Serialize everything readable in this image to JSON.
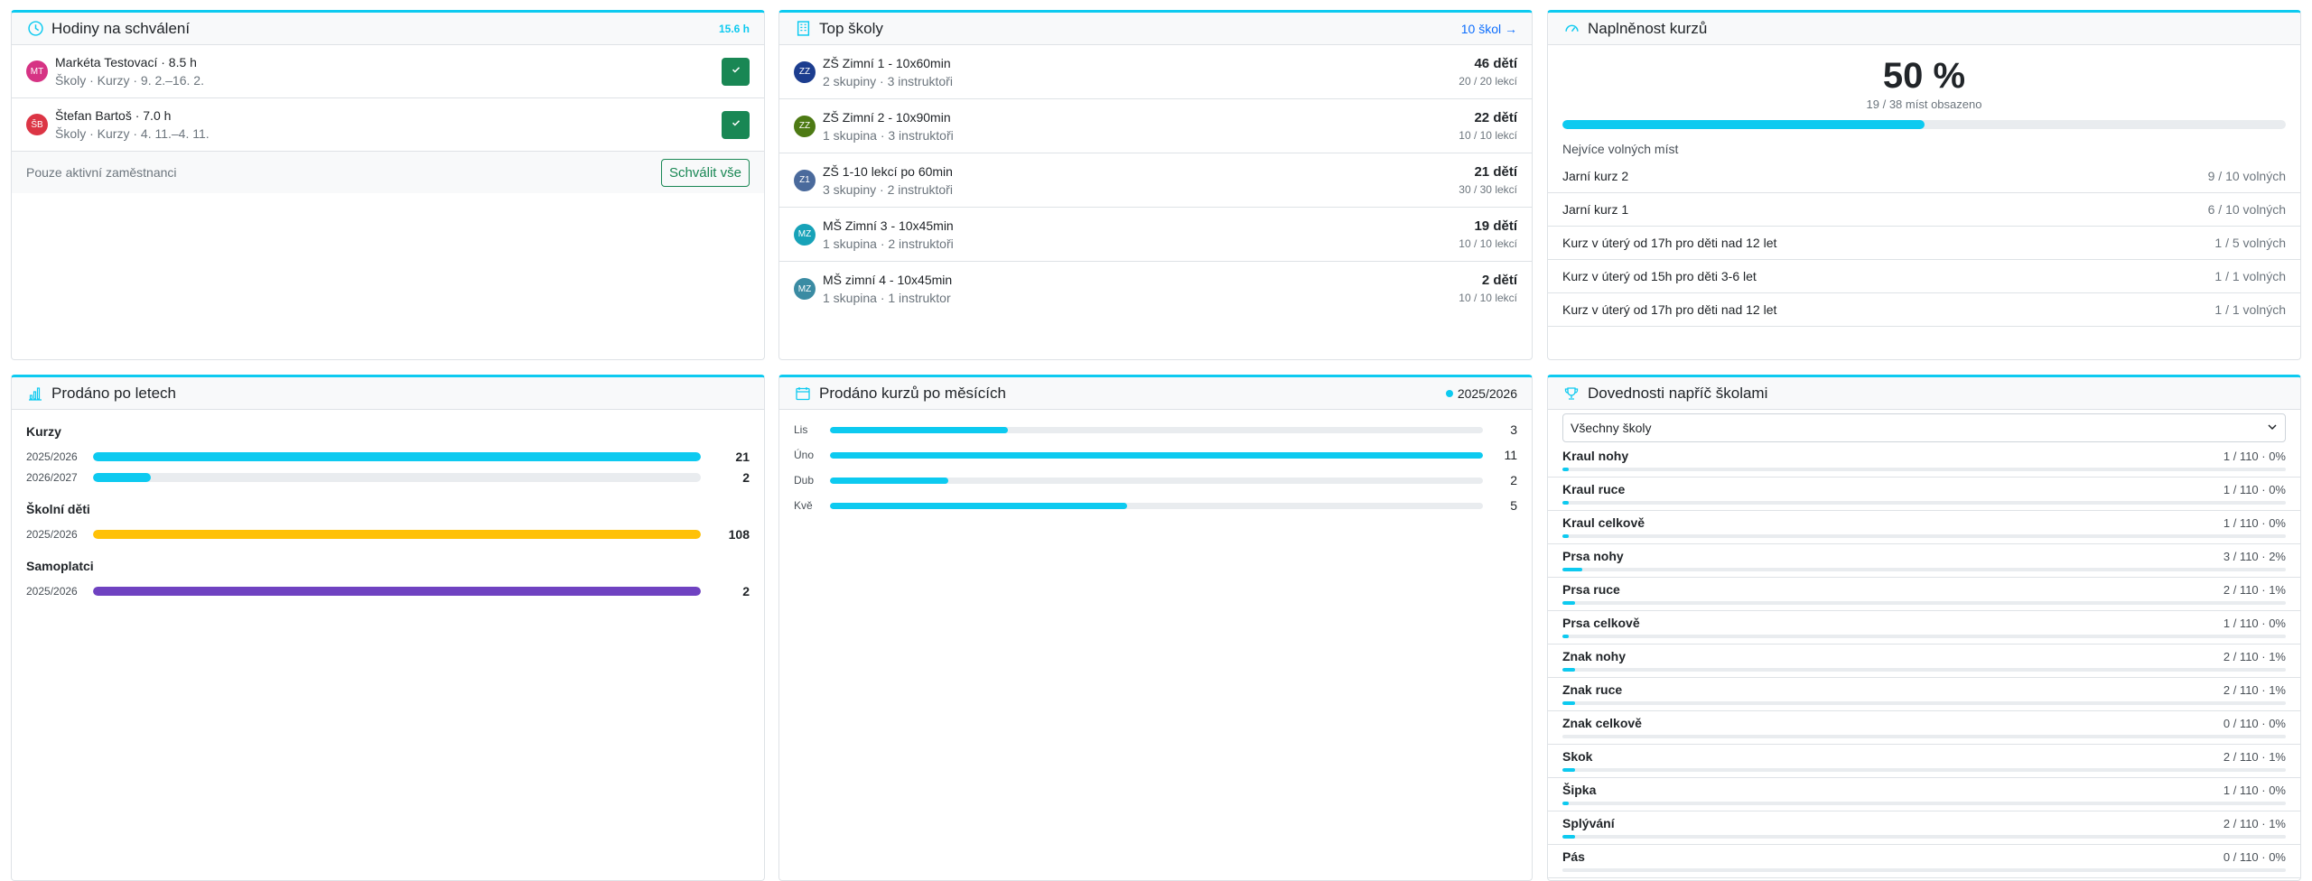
{
  "approvals": {
    "title": "Hodiny na schválení",
    "total": "15.6 h",
    "items": [
      {
        "initials": "MT",
        "color": "#d63384",
        "name": "Markéta Testovací · 8.5 h",
        "sub": "Školy · Kurzy · 9. 2.–16. 2."
      },
      {
        "initials": "ŠB",
        "color": "#dc3545",
        "name": "Štefan Bartoš · 7.0 h",
        "sub": "Školy · Kurzy · 4. 11.–4. 11."
      }
    ],
    "footer_text": "Pouze aktivní zaměstnanci",
    "approve_all": "Schválit vše"
  },
  "schools": {
    "title": "Top školy",
    "link": "10 škol →",
    "items": [
      {
        "initials": "ZZ",
        "color": "#1c3d8f",
        "name": "ZŠ Zimní 1 - 10x60min",
        "sub": "2 skupiny · 3 instruktoři",
        "kids": "46 dětí",
        "lessons": "20 / 20 lekcí"
      },
      {
        "initials": "ZZ",
        "color": "#4d7a14",
        "name": "ZŠ Zimní 2 - 10x90min",
        "sub": "1 skupina · 3 instruktoři",
        "kids": "22 dětí",
        "lessons": "10 / 10 lekcí"
      },
      {
        "initials": "Z1",
        "color": "#4a6a9c",
        "name": "ZŠ 1-10 lekcí po 60min",
        "sub": "3 skupiny · 2 instruktoři",
        "kids": "21 dětí",
        "lessons": "30 / 30 lekcí"
      },
      {
        "initials": "MZ",
        "color": "#17a2b8",
        "name": "MŠ Zimní 3 - 10x45min",
        "sub": "1 skupina · 2 instruktoři",
        "kids": "19 dětí",
        "lessons": "10 / 10 lekcí"
      },
      {
        "initials": "MZ",
        "color": "#3a8ba3",
        "name": "MŠ zimní 4 - 10x45min",
        "sub": "1 skupina · 1 instruktor",
        "kids": "2 dětí",
        "lessons": "10 / 10 lekcí"
      }
    ]
  },
  "capacity": {
    "title": "Naplněnost kurzů",
    "percent": "50 %",
    "occupied": "19 / 38 míst obsazeno",
    "fill": 0.5,
    "free_title": "Nejvíce volných míst",
    "free": [
      {
        "name": "Jarní kurz 2",
        "val": "9 / 10 volných"
      },
      {
        "name": "Jarní kurz 1",
        "val": "6 / 10 volných"
      },
      {
        "name": "Kurz v úterý od 17h pro děti nad 12 let",
        "val": "1 / 5 volných"
      },
      {
        "name": "Kurz v úterý od 15h pro děti 3-6 let",
        "val": "1 / 1 volných"
      },
      {
        "name": "Kurz v úterý od 17h pro děti nad 12 let",
        "val": "1 / 1 volných"
      }
    ]
  },
  "sold_years": {
    "title": "Prodáno po letech",
    "groups": [
      {
        "name": "Kurzy",
        "color": "#0dcaf0",
        "rows": [
          {
            "year": "2025/2026",
            "value": 21,
            "label": "21"
          },
          {
            "year": "2026/2027",
            "value": 2,
            "label": "2"
          }
        ],
        "max": 21
      },
      {
        "name": "Školní děti",
        "color": "#ffc107",
        "rows": [
          {
            "year": "2025/2026",
            "value": 108,
            "label": "108"
          }
        ],
        "max": 108
      },
      {
        "name": "Samoplatci",
        "color": "#6f42c1",
        "rows": [
          {
            "year": "2025/2026",
            "value": 2,
            "label": "2"
          }
        ],
        "max": 2
      }
    ]
  },
  "sold_months": {
    "title": "Prodáno kurzů po měsících",
    "legend": "2025/2026",
    "max": 11,
    "rows": [
      {
        "month": "Lis",
        "value": 3,
        "label": "3"
      },
      {
        "month": "Úno",
        "value": 11,
        "label": "11"
      },
      {
        "month": "Dub",
        "value": 2,
        "label": "2"
      },
      {
        "month": "Kvě",
        "value": 5,
        "label": "5"
      }
    ]
  },
  "skills": {
    "title": "Dovednosti napříč školami",
    "select": "Všechny školy",
    "items": [
      {
        "name": "Kraul nohy",
        "val": "1 / 110 · 0%",
        "pct": 0.009
      },
      {
        "name": "Kraul ruce",
        "val": "1 / 110 · 0%",
        "pct": 0.009
      },
      {
        "name": "Kraul celkově",
        "val": "1 / 110 · 0%",
        "pct": 0.009
      },
      {
        "name": "Prsa nohy",
        "val": "3 / 110 · 2%",
        "pct": 0.027
      },
      {
        "name": "Prsa ruce",
        "val": "2 / 110 · 1%",
        "pct": 0.018
      },
      {
        "name": "Prsa celkově",
        "val": "1 / 110 · 0%",
        "pct": 0.009
      },
      {
        "name": "Znak nohy",
        "val": "2 / 110 · 1%",
        "pct": 0.018
      },
      {
        "name": "Znak ruce",
        "val": "2 / 110 · 1%",
        "pct": 0.018
      },
      {
        "name": "Znak celkově",
        "val": "0 / 110 · 0%",
        "pct": 0
      },
      {
        "name": "Skok",
        "val": "2 / 110 · 1%",
        "pct": 0.018
      },
      {
        "name": "Šipka",
        "val": "1 / 110 · 0%",
        "pct": 0.009
      },
      {
        "name": "Splývání",
        "val": "2 / 110 · 1%",
        "pct": 0.018
      },
      {
        "name": "Pás",
        "val": "0 / 110 · 0%",
        "pct": 0
      }
    ]
  }
}
